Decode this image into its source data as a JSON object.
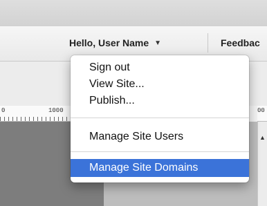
{
  "header": {
    "greeting": "Hello, User Name",
    "feedback": "Feedbac"
  },
  "ruler": {
    "left_label": "0",
    "mark_label": "1000",
    "right_label": "00"
  },
  "dropdown": {
    "items": [
      {
        "label": "Sign out"
      },
      {
        "label": "View Site..."
      },
      {
        "label": "Publish..."
      },
      {
        "label": "Manage Site Users"
      },
      {
        "label": "Manage Site Domains",
        "highlighted": true
      }
    ]
  },
  "colors": {
    "highlight": "#3b73d9"
  }
}
